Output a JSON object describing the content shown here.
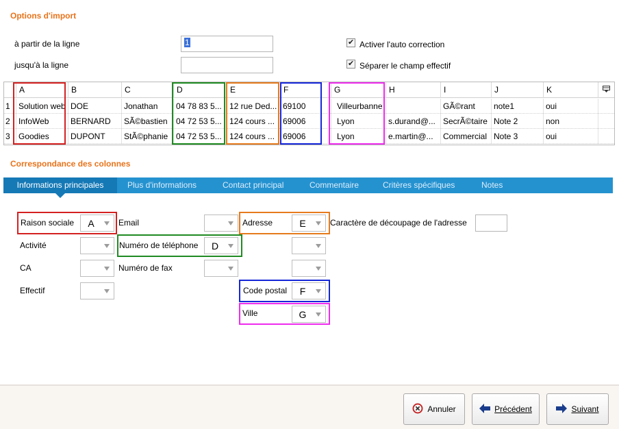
{
  "import_options": {
    "title": "Options d'import",
    "from_line_label": "à partir de la ligne",
    "from_line_value": "1",
    "to_line_label": "jusqu'à la ligne",
    "to_line_value": "",
    "auto_correction_label": "Activer l'auto correction",
    "auto_correction_checked": true,
    "split_effective_label": "Séparer le champ effectif",
    "split_effective_checked": true
  },
  "grid": {
    "columns": [
      "A",
      "B",
      "C",
      "D",
      "E",
      "F",
      "G",
      "H",
      "I",
      "J",
      "K"
    ],
    "rows": [
      {
        "num": "1",
        "cells": [
          "Solution web",
          "DOE",
          "Jonathan",
          "04 78 83 5...",
          "12 rue Ded...",
          "69100",
          "Villeurbanne",
          "",
          "GÃ©rant",
          "note1",
          "oui"
        ]
      },
      {
        "num": "2",
        "cells": [
          "InfoWeb",
          "BERNARD",
          "SÃ©bastien",
          "04 72 53 5...",
          "124 cours ...",
          "69006",
          "Lyon",
          "s.durand@...",
          "SecrÃ©taire",
          "Note 2",
          "non"
        ]
      },
      {
        "num": "3",
        "cells": [
          "Goodies",
          "DUPONT",
          "StÃ©phanie",
          "04 72 53 5...",
          "124 cours ...",
          "69006",
          "Lyon",
          "e.martin@...",
          "Commercial",
          "Note 3",
          "oui"
        ]
      }
    ],
    "menu_icon": "column-menu-icon"
  },
  "mapping": {
    "title": "Correspondance des colonnes",
    "tabs": [
      {
        "label": "Informations principales",
        "active": true
      },
      {
        "label": "Plus d'informations",
        "active": false
      },
      {
        "label": "Contact principal",
        "active": false
      },
      {
        "label": "Commentaire",
        "active": false
      },
      {
        "label": "Critères spécifiques",
        "active": false
      },
      {
        "label": "Notes",
        "active": false
      }
    ],
    "fields": {
      "raison_sociale": {
        "label": "Raison sociale",
        "value": "A"
      },
      "activite": {
        "label": "Activité",
        "value": ""
      },
      "ca": {
        "label": "CA",
        "value": ""
      },
      "effectif": {
        "label": "Effectif",
        "value": ""
      },
      "email": {
        "label": "Email",
        "value": ""
      },
      "telephone": {
        "label": "Numéro de téléphone",
        "value": "D"
      },
      "fax": {
        "label": "Numéro de fax",
        "value": ""
      },
      "adresse": {
        "label": "Adresse",
        "value": "E"
      },
      "adresse2": {
        "value": ""
      },
      "adresse3": {
        "value": ""
      },
      "code_postal": {
        "label": "Code postal",
        "value": "F"
      },
      "ville": {
        "label": "Ville",
        "value": "G"
      },
      "split_char_label": "Caractère de découpage de l'adresse",
      "split_char_value": ""
    }
  },
  "footer": {
    "cancel_label": "Annuler",
    "prev_label": "Précédent",
    "next_label": "Suivant"
  },
  "colors": {
    "accent_orange": "#e8731a",
    "tab_bar": "#2592d0",
    "frame_red": "#d42020",
    "frame_green": "#1f8a22",
    "frame_orange": "#e57a1c",
    "frame_blue": "#1426d8",
    "frame_magenta": "#ee2bee"
  }
}
